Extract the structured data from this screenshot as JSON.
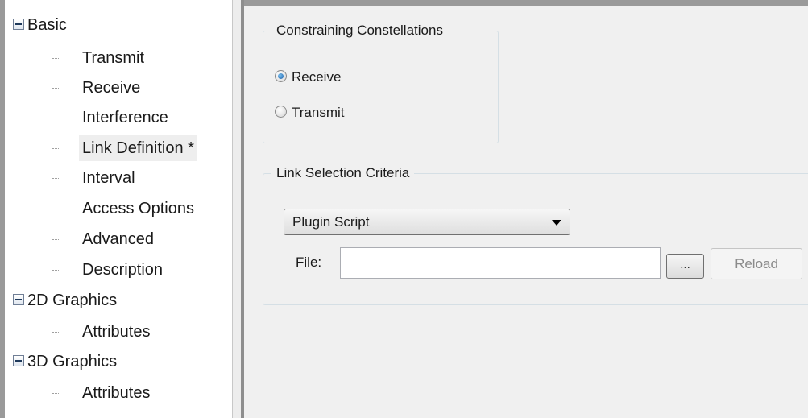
{
  "tree": {
    "groups": [
      {
        "label": "Basic",
        "children": [
          "Transmit",
          "Receive",
          "Interference",
          "Link Definition *",
          "Interval",
          "Access Options",
          "Advanced",
          "Description"
        ]
      },
      {
        "label": "2D Graphics",
        "children": [
          "Attributes"
        ]
      },
      {
        "label": "3D Graphics",
        "children": [
          "Attributes"
        ]
      }
    ],
    "selected": "Link Definition *"
  },
  "constellations": {
    "title": "Constraining Constellations",
    "options": [
      {
        "label": "Receive",
        "checked": true
      },
      {
        "label": "Transmit",
        "checked": false
      }
    ]
  },
  "criteria": {
    "title": "Link Selection Criteria",
    "selected_value": "Plugin Script",
    "file_label": "File:",
    "file_value": "",
    "browse_label": "...",
    "reload_label": "Reload"
  },
  "colors": {
    "panel_bg": "#f0f0f0",
    "radio_checked": "#1a5fa8",
    "disabled_text": "#8b8b8b"
  }
}
